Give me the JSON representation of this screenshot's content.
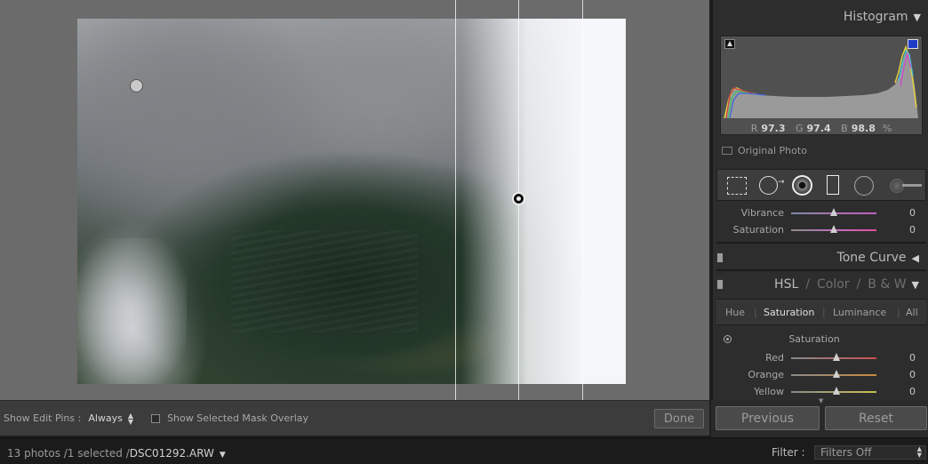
{
  "panel": {
    "histogram_title": "Histogram",
    "rgb": {
      "r_label": "R",
      "r_value": "97.3",
      "g_label": "G",
      "g_value": "97.4",
      "b_label": "B",
      "b_value": "98.8",
      "unit": "%"
    },
    "original_photo_label": "Original Photo",
    "basic_sliders": [
      {
        "label": "Vibrance",
        "value": "0",
        "thumb_pct": 50
      },
      {
        "label": "Saturation",
        "value": "0",
        "thumb_pct": 50
      }
    ],
    "tone_curve_title": "Tone Curve",
    "hsl_title": {
      "hsl": "HSL",
      "sep1": "/",
      "color": "Color",
      "sep2": "/",
      "bw": "B & W"
    },
    "hsl_tabs": {
      "hue": "Hue",
      "saturation": "Saturation",
      "luminance": "Luminance",
      "all": "All",
      "active": "saturation"
    },
    "saturation_section_title": "Saturation",
    "hsl_sliders": [
      {
        "label": "Red",
        "value": "0",
        "thumb_pct": 50,
        "color": "#c85050"
      },
      {
        "label": "Orange",
        "value": "0",
        "thumb_pct": 50,
        "color": "#c88a40"
      },
      {
        "label": "Yellow",
        "value": "0",
        "thumb_pct": 50,
        "color": "#c8c050"
      }
    ],
    "previous_label": "Previous",
    "reset_label": "Reset"
  },
  "toolbar": {
    "show_edit_pins_label": "Show Edit Pins :",
    "show_edit_pins_value": "Always",
    "show_mask_overlay_label": "Show Selected Mask Overlay",
    "done_label": "Done"
  },
  "filmstrip": {
    "count_text": "13 photos /1 selected /",
    "filename": "DSC01292.ARW",
    "filter_label": "Filter :",
    "filter_value": "Filters Off"
  },
  "icons": {
    "crop": "crop-overlay-icon",
    "spot": "spot-removal-icon",
    "redeye": "red-eye-correction-icon",
    "graduated": "graduated-filter-icon",
    "radial": "radial-filter-icon",
    "brush": "adjustment-brush-icon"
  }
}
